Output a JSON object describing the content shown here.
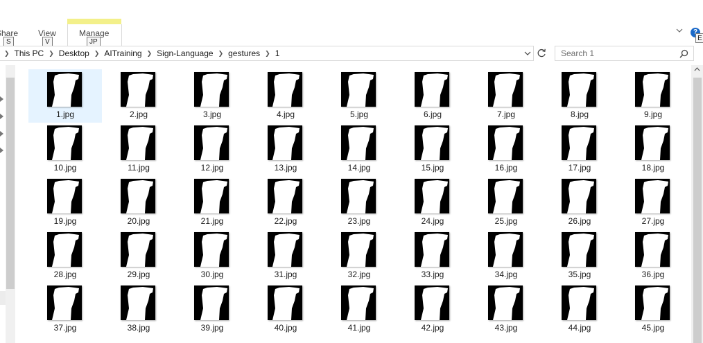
{
  "ribbon": {
    "tabs": [
      {
        "label": "Share",
        "keytip": "S"
      },
      {
        "label": "View",
        "keytip": "V"
      },
      {
        "label": "Manage",
        "keytip": "JP"
      }
    ],
    "help_label": "?",
    "help_keytip": "E"
  },
  "address": {
    "crumbs": [
      "This PC",
      "Desktop",
      "AITraining",
      "Sign-Language",
      "gestures",
      "1"
    ]
  },
  "search": {
    "placeholder": "Search 1"
  },
  "files": [
    {
      "name": "1.jpg",
      "selected": true
    },
    {
      "name": "2.jpg"
    },
    {
      "name": "3.jpg"
    },
    {
      "name": "4.jpg"
    },
    {
      "name": "5.jpg"
    },
    {
      "name": "6.jpg"
    },
    {
      "name": "7.jpg"
    },
    {
      "name": "8.jpg"
    },
    {
      "name": "9.jpg"
    },
    {
      "name": "10.jpg"
    },
    {
      "name": "11.jpg"
    },
    {
      "name": "12.jpg"
    },
    {
      "name": "13.jpg"
    },
    {
      "name": "14.jpg"
    },
    {
      "name": "15.jpg"
    },
    {
      "name": "16.jpg"
    },
    {
      "name": "17.jpg"
    },
    {
      "name": "18.jpg"
    },
    {
      "name": "19.jpg"
    },
    {
      "name": "20.jpg"
    },
    {
      "name": "21.jpg"
    },
    {
      "name": "22.jpg"
    },
    {
      "name": "23.jpg"
    },
    {
      "name": "24.jpg"
    },
    {
      "name": "25.jpg"
    },
    {
      "name": "26.jpg"
    },
    {
      "name": "27.jpg"
    },
    {
      "name": "28.jpg"
    },
    {
      "name": "29.jpg"
    },
    {
      "name": "30.jpg"
    },
    {
      "name": "31.jpg"
    },
    {
      "name": "32.jpg"
    },
    {
      "name": "33.jpg"
    },
    {
      "name": "34.jpg"
    },
    {
      "name": "35.jpg"
    },
    {
      "name": "36.jpg"
    },
    {
      "name": "37.jpg"
    },
    {
      "name": "38.jpg"
    },
    {
      "name": "39.jpg"
    },
    {
      "name": "40.jpg"
    },
    {
      "name": "41.jpg"
    },
    {
      "name": "42.jpg"
    },
    {
      "name": "43.jpg"
    },
    {
      "name": "44.jpg"
    },
    {
      "name": "45.jpg"
    }
  ],
  "colors": {
    "manage_accent": "#f3f08a",
    "selection": "#e5f3ff",
    "help_blue": "#1b6ac9"
  }
}
